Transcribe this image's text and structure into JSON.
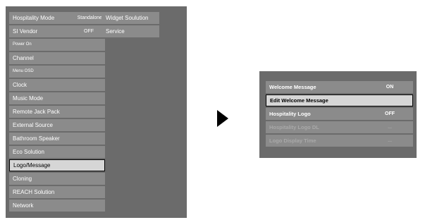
{
  "left_menu": {
    "items": [
      {
        "label": "Hospitality Mode",
        "value": "Standalone"
      },
      {
        "label": "SI Vendor",
        "value": "OFF"
      },
      {
        "label": "Power On",
        "value": ""
      },
      {
        "label": "Channel",
        "value": ""
      },
      {
        "label": "Menu OSD",
        "value": ""
      },
      {
        "label": "Clock",
        "value": ""
      },
      {
        "label": "Music Mode",
        "value": ""
      },
      {
        "label": "Remote Jack Pack",
        "value": ""
      },
      {
        "label": "External Source",
        "value": ""
      },
      {
        "label": "Bathroom Speaker",
        "value": ""
      },
      {
        "label": "Eco Solution",
        "value": ""
      },
      {
        "label": "Logo/Message",
        "value": ""
      },
      {
        "label": "Cloning",
        "value": ""
      },
      {
        "label": "REACH Solution",
        "value": ""
      },
      {
        "label": "Network",
        "value": ""
      }
    ],
    "selected_index": 11
  },
  "submenu": {
    "items": [
      "Widget Soulution",
      "Service"
    ]
  },
  "logo_message_menu": {
    "items": [
      {
        "label": "Welcome Message",
        "value": "ON",
        "enabled": true
      },
      {
        "label": "Edit Welcome Message",
        "value": "",
        "enabled": true
      },
      {
        "label": "Hospitality Logo",
        "value": "OFF",
        "enabled": true
      },
      {
        "label": "Hospitality Logo DL",
        "value": "...",
        "enabled": false
      },
      {
        "label": "Logo Display Time",
        "value": "...",
        "enabled": false
      }
    ],
    "selected_index": 1
  },
  "arrow_icon": "right-triangle-icon",
  "colors": {
    "panel": "#6b6b6b",
    "row": "#8b8b8b",
    "selected_row": "#d6d6d6",
    "text": "#ffffff",
    "disabled_text": "#a9a9a9"
  }
}
